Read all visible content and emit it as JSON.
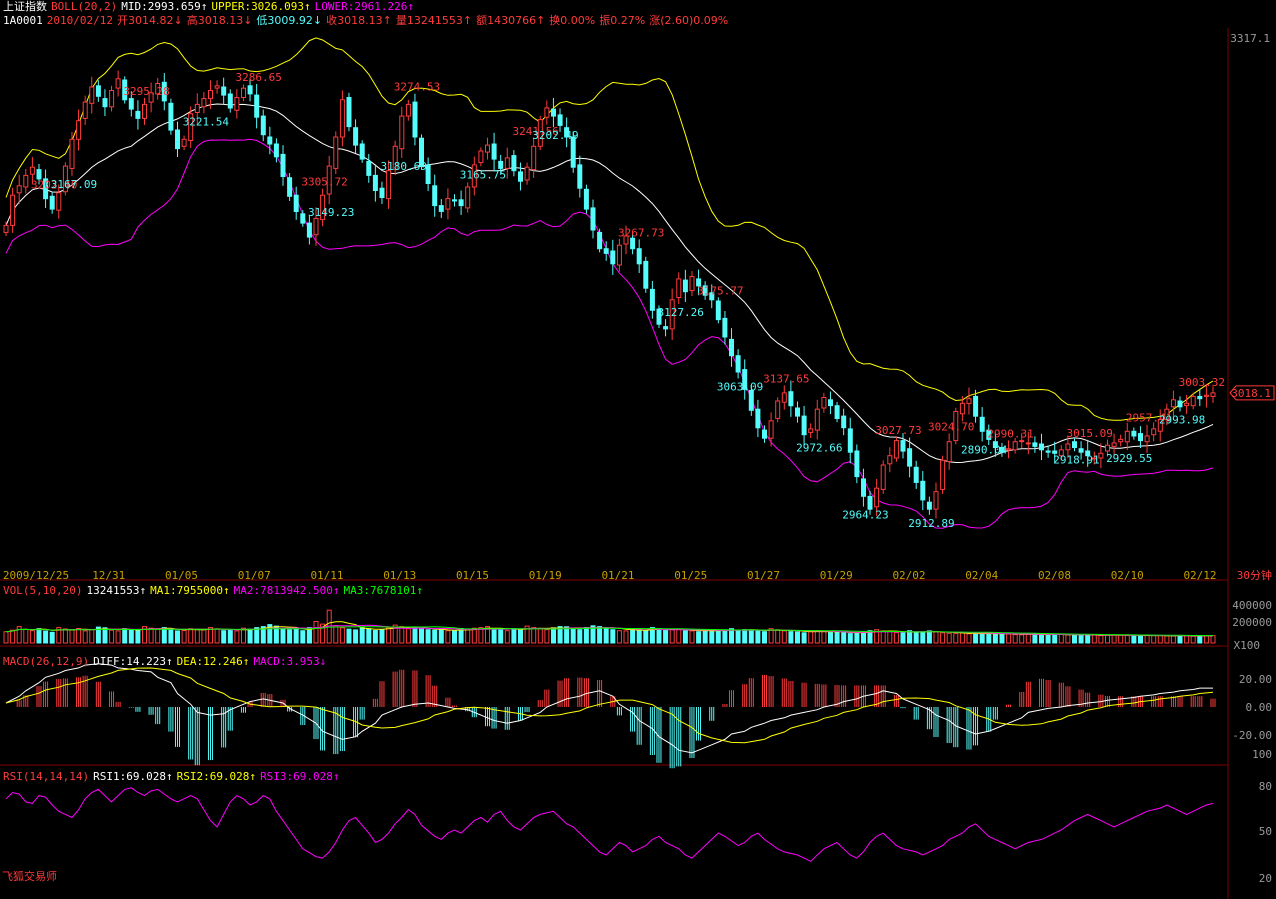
{
  "header": {
    "title": "上证指数",
    "boll_label": "BOLL(20,2)",
    "mid": "MID:2993.659↑",
    "upper": "UPPER:3026.093↑",
    "lower": "LOWER:2961.226↑",
    "code": "1A0001",
    "date": "2010/02/12",
    "open": "开3014.82↓",
    "high": "高3018.13↓",
    "low": "低3009.92↓",
    "close": "收3018.13↑",
    "volume": "量13241553↑",
    "amount": "额1430766↑",
    "turnover": "换0.00%",
    "amplitude": "振0.27%",
    "change": "涨(2.60)0.09%"
  },
  "vol_header": {
    "label": "VOL(5,10,20)",
    "value": "13241553↑",
    "ma1": "MA1:7955000↑",
    "ma2": "MA2:7813942.500↑",
    "ma3": "MA3:7678101↑"
  },
  "macd_header": {
    "label": "MACD(26,12,9)",
    "diff": "DIFF:14.223↑",
    "dea": "DEA:12.246↑",
    "macd": "MACD:3.953↓"
  },
  "rsi_header": {
    "label": "RSI(14,14,14)",
    "rsi1": "RSI1:69.028↑",
    "rsi2": "RSI2:69.028↑",
    "rsi3": "RSI3:69.028↑"
  },
  "watermark": "飞狐交易师",
  "period_label": "30分钟",
  "last_price_tag": "3018.1",
  "colors": {
    "up": "#ff3b3b",
    "down": "#54fcfc",
    "mid": "#ffffff",
    "upper": "#ffff00",
    "lower": "#ff00ff",
    "axis": "#7f0000",
    "muted": "#9a9a9a",
    "ma3": "#00ff00",
    "rsi": "#ff00ff"
  },
  "chart_data": [
    {
      "type": "candlestick",
      "title": "上证指数 30分钟",
      "x_tick_labels": [
        "2009/12/25",
        "12/31",
        "01/05",
        "01/07",
        "01/11",
        "01/13",
        "01/15",
        "01/19",
        "01/21",
        "01/25",
        "01/27",
        "01/29",
        "02/02",
        "02/04",
        "02/08",
        "02/10",
        "02/12"
      ],
      "y_tick_labels": [
        "3317.1"
      ],
      "last_price": "3018.1",
      "annotations_high": [
        "3202.40",
        "3295.28",
        "3286.65",
        "3305.72",
        "3274.53",
        "3241.56",
        "3267.73",
        "3175.77",
        "3137.65",
        "3027.73",
        "3024.70",
        "2990.31",
        "3015.09",
        "2957.41",
        "3003.32"
      ],
      "annotations_low": [
        "3167.09",
        "3221.54",
        "3149.23",
        "3180.69",
        "3165.75",
        "3202.49",
        "3127.26",
        "3063.09",
        "2972.66",
        "2964.23",
        "2912.89",
        "2890.04",
        "2918.91",
        "2929.55",
        "2993.98"
      ],
      "closes": [
        3162,
        3188,
        3196,
        3205,
        3212,
        3202,
        3185,
        3176,
        3190,
        3213,
        3236,
        3252,
        3268,
        3281,
        3273,
        3264,
        3278,
        3288,
        3270,
        3262,
        3254,
        3266,
        3276,
        3284,
        3269,
        3244,
        3228,
        3236,
        3258,
        3266,
        3271,
        3278,
        3282,
        3274,
        3263,
        3272,
        3280,
        3275,
        3255,
        3240,
        3232,
        3221,
        3204,
        3187,
        3174,
        3164,
        3152,
        3168,
        3188,
        3213,
        3238,
        3270,
        3247,
        3231,
        3219,
        3205,
        3192,
        3186,
        3209,
        3230,
        3256,
        3266,
        3238,
        3213,
        3198,
        3179,
        3174,
        3185,
        3183,
        3179,
        3195,
        3214,
        3226,
        3231,
        3219,
        3211,
        3220,
        3209,
        3200,
        3212,
        3230,
        3253,
        3263,
        3256,
        3248,
        3238,
        3212,
        3194,
        3176,
        3158,
        3142,
        3138,
        3129,
        3145,
        3153,
        3142,
        3129,
        3108,
        3089,
        3077,
        3073,
        3098,
        3116,
        3105,
        3118,
        3110,
        3102,
        3098,
        3081,
        3066,
        3050,
        3036,
        3021,
        3003,
        2988,
        2979,
        2994,
        3011,
        3018,
        3007,
        2998,
        2982,
        2987,
        3004,
        3014,
        3007,
        2996,
        2988,
        2967,
        2946,
        2929,
        2918,
        2936,
        2956,
        2964,
        2977,
        2968,
        2955,
        2941,
        2926,
        2918,
        2933,
        2960,
        2976,
        3002,
        3009,
        3013,
        2998,
        2985,
        2978,
        2971,
        2967,
        2970,
        2976,
        2977,
        2975,
        2972,
        2969,
        2967,
        2966,
        2969,
        2974,
        2971,
        2967,
        2964,
        2962,
        2966,
        2973,
        2975,
        2978,
        2985,
        2981,
        2977,
        2981,
        2987,
        2995,
        3004,
        3012,
        3006,
        3009,
        3015,
        3013,
        3016,
        3018
      ]
    },
    {
      "type": "bar",
      "title": "VOL(5,10,20)",
      "y_tick_labels": [
        "400000",
        "200000",
        "X100"
      ],
      "volumes": [
        110,
        125,
        160,
        135,
        120,
        140,
        115,
        105,
        150,
        138,
        128,
        142,
        118,
        130,
        155,
        148,
        125,
        118,
        140,
        132,
        122,
        160,
        145,
        135,
        150,
        128,
        118,
        122,
        140,
        135,
        128,
        150,
        138,
        120,
        130,
        118,
        145,
        135,
        150,
        160,
        180,
        165,
        140,
        130,
        145,
        120,
        110,
        150,
        210,
        185,
        320,
        170,
        148,
        135,
        128,
        150,
        140,
        122,
        130,
        150,
        175,
        160,
        140,
        150,
        138,
        130,
        125,
        128,
        120,
        118,
        142,
        130,
        145,
        150,
        160,
        138,
        128,
        120,
        140,
        132,
        165,
        150,
        138,
        130,
        148,
        160,
        158,
        140,
        130,
        150,
        168,
        160,
        140,
        130,
        120,
        118,
        135,
        128,
        120,
        150,
        140,
        130,
        128,
        132,
        120,
        118,
        110,
        128,
        120,
        118,
        128,
        140,
        122,
        130,
        128,
        118,
        110,
        140,
        130,
        118,
        110,
        108,
        100,
        118,
        120,
        110,
        102,
        108,
        100,
        92,
        98,
        110,
        120,
        130,
        118,
        110,
        102,
        98,
        120,
        110,
        100,
        108,
        118,
        110,
        100,
        95,
        92,
        98,
        90,
        88,
        92,
        95,
        90,
        85,
        88,
        82,
        80,
        85,
        88,
        80,
        78,
        82,
        85,
        80,
        78,
        74,
        80,
        78,
        72,
        75,
        80,
        76,
        72,
        74,
        70,
        72,
        74,
        72,
        70,
        68,
        72,
        70,
        66,
        68,
        70,
        72
      ]
    },
    {
      "type": "bar+line",
      "title": "MACD(26,12,9)",
      "y_tick_labels": [
        "20.00",
        "0.00",
        "-20.00"
      ],
      "diff": [
        3,
        8,
        12,
        18,
        22,
        25,
        27,
        29,
        31,
        32,
        31,
        29,
        28,
        27,
        26,
        22,
        18,
        10,
        2,
        -4,
        -6,
        -5,
        -2,
        2,
        4,
        6,
        5,
        3,
        -1,
        -6,
        -12,
        -18,
        -22,
        -24,
        -22,
        -18,
        -12,
        -6,
        -2,
        0,
        2,
        3,
        2,
        0,
        -1,
        -2,
        -4,
        -8,
        -10,
        -12,
        -10,
        -8,
        -4,
        0,
        4,
        6,
        8,
        10,
        12,
        8,
        2,
        -4,
        -10,
        -16,
        -22,
        -28,
        -32,
        -34,
        -32,
        -28,
        -24,
        -20,
        -18,
        -15,
        -12,
        -10,
        -8,
        -6,
        -4,
        -2,
        0,
        2,
        4,
        6,
        8,
        10,
        12,
        10,
        6,
        2,
        -2,
        -6,
        -10,
        -14,
        -18,
        -20,
        -18,
        -16,
        -12,
        -8,
        -4,
        -2,
        -1,
        0,
        1,
        2,
        3,
        4,
        5,
        6,
        7,
        8,
        9,
        10,
        11,
        12,
        13,
        14,
        14
      ]
    },
    {
      "type": "line",
      "title": "RSI(14,14,14)",
      "y_tick_labels": [
        "100",
        "80",
        "50",
        "20"
      ],
      "ylim": [
        20,
        100
      ],
      "rsi": [
        72,
        76,
        75,
        70,
        69,
        74,
        73,
        68,
        64,
        60,
        65,
        72,
        76,
        78,
        74,
        70,
        74,
        78,
        79,
        76,
        74,
        77,
        78,
        75,
        72,
        70,
        74,
        72,
        65,
        58,
        54,
        62,
        70,
        74,
        72,
        68,
        70,
        74,
        72,
        64,
        58,
        52,
        46,
        40,
        35,
        34,
        38,
        44,
        52,
        58,
        60,
        55,
        50,
        44,
        46,
        50,
        56,
        60,
        65,
        62,
        55,
        48,
        46,
        50,
        52,
        50,
        54,
        58,
        60,
        57,
        62,
        64,
        58,
        54,
        52,
        56,
        60,
        62,
        64,
        60,
        56,
        54,
        50,
        46,
        42,
        38,
        36,
        40,
        44,
        42,
        38,
        40,
        42,
        46,
        48,
        44,
        40,
        36,
        34,
        38,
        42,
        46,
        50,
        48,
        45,
        42,
        44,
        48,
        50,
        46,
        43,
        40,
        38,
        36,
        34,
        32,
        36,
        40,
        42,
        44,
        40,
        36,
        34,
        38,
        44,
        48,
        50,
        46,
        42,
        40,
        38,
        36,
        38,
        40,
        42,
        46,
        48,
        50,
        54,
        56,
        52,
        48,
        46,
        44,
        42,
        40,
        42,
        44,
        46,
        48,
        50,
        52,
        55,
        58,
        60,
        62,
        60,
        58,
        56,
        54,
        56,
        58,
        60,
        62,
        64,
        66,
        68,
        66,
        64,
        62,
        64,
        66,
        68,
        69
      ]
    }
  ]
}
